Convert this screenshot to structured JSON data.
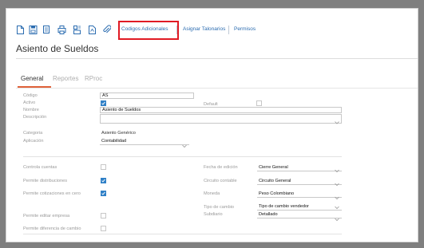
{
  "toolbar": {
    "icons": [
      "new-document-icon",
      "save-icon",
      "copy-icon",
      "print-icon",
      "archive-icon",
      "export-icon",
      "attachment-icon"
    ],
    "link_codigos": "Codigos Adicionales",
    "link_talonarios": "Asignar Talonarios",
    "link_permisos": "Permisos"
  },
  "colors": {
    "accent": "#e0623a",
    "link": "#2b6cb0",
    "highlight": "#e01b24",
    "checkbox": "#2f80c7"
  },
  "page": {
    "title": "Asiento de Sueldos"
  },
  "tabs": [
    {
      "label": "General",
      "active": true
    },
    {
      "label": "Reportes",
      "active": false
    },
    {
      "label": "RProc",
      "active": false
    }
  ],
  "form": {
    "codigo_label": "Código",
    "codigo_value": "AS",
    "activo_label": "Activo",
    "activo_checked": true,
    "default_label": "Default",
    "default_checked": false,
    "nombre_label": "Nombre",
    "nombre_value": "Asiento de Sueldos",
    "descripcion_label": "Descripción",
    "descripcion_value": "",
    "categoria_label": "Categoria",
    "categoria_value": "Asiento Genérico",
    "aplicacion_label": "Aplicación",
    "aplicacion_value": "Contabilidad",
    "controla_cuentas_label": "Controla cuentas",
    "controla_cuentas_checked": false,
    "permite_distribuciones_label": "Permite distribuciones",
    "permite_distribuciones_checked": true,
    "permite_cotizaciones_label": "Permite cotizaciones en cero",
    "permite_cotizaciones_checked": true,
    "permite_editar_empresa_label": "Permite editar empresa",
    "permite_editar_empresa_checked": false,
    "permite_diferencia_label": "Permite diferencia de cambio",
    "permite_diferencia_checked": false,
    "fecha_edicion_label": "Fecha de edición",
    "fecha_edicion_value": "Cierre General",
    "circuito_label": "Circuito contable",
    "circuito_value": "Circuito General",
    "moneda_label": "Moneda",
    "moneda_value": "Peso Colombiano",
    "tipo_cambio_label": "Tipo de cambio",
    "tipo_cambio_value": "Tipo de cambio vendedor",
    "subdiario_label": "Subdiario",
    "subdiario_value": "Detallado"
  }
}
